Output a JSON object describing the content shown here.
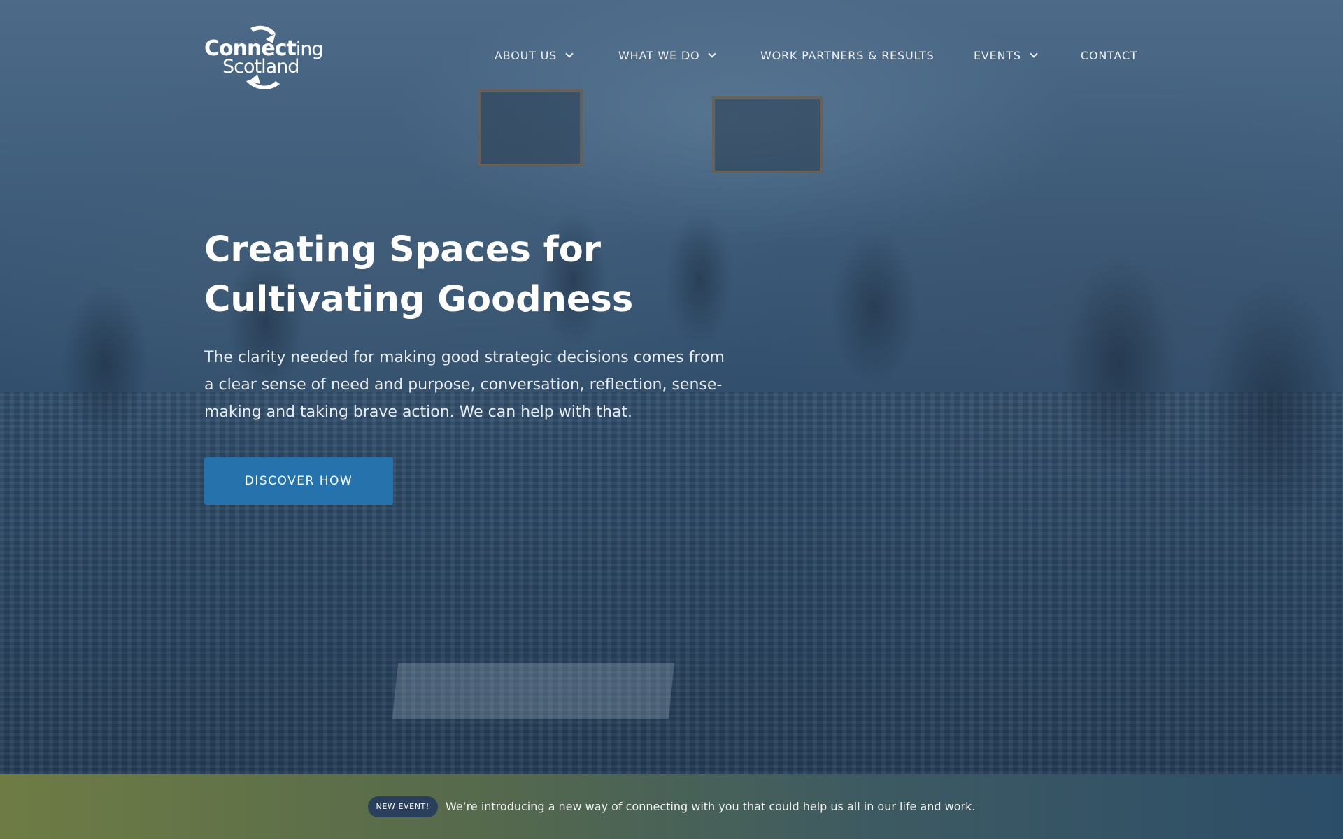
{
  "logo": {
    "line1_bold": "Connect",
    "line1_light": "ing",
    "line2": "Scotland"
  },
  "nav": {
    "items": [
      {
        "label": "ABOUT US",
        "has_dropdown": true
      },
      {
        "label": "WHAT WE DO",
        "has_dropdown": true
      },
      {
        "label": "WORK PARTNERS & RESULTS",
        "has_dropdown": false
      },
      {
        "label": "EVENTS",
        "has_dropdown": true
      },
      {
        "label": "CONTACT",
        "has_dropdown": false
      }
    ]
  },
  "hero": {
    "title_line1": "Creating Spaces for",
    "title_line2": "Cultivating Goodness",
    "text": "The clarity needed for making good strategic decisions comes from a clear sense of need and purpose, conversation, reflection, sense-making and taking brave action. We can help with that.",
    "cta_label": "DISCOVER HOW"
  },
  "announcement": {
    "badge": "NEW EVENT!",
    "text": "We’re introducing a new way of connecting with you that could help us all in our life and work."
  },
  "colors": {
    "cta": "#2572ad",
    "badge": "#2a3f5c",
    "bar_left": "#6e7c44",
    "bar_right": "#2c4d68"
  },
  "icons": [
    "chevron-down-icon",
    "logo-swoosh-icon"
  ]
}
